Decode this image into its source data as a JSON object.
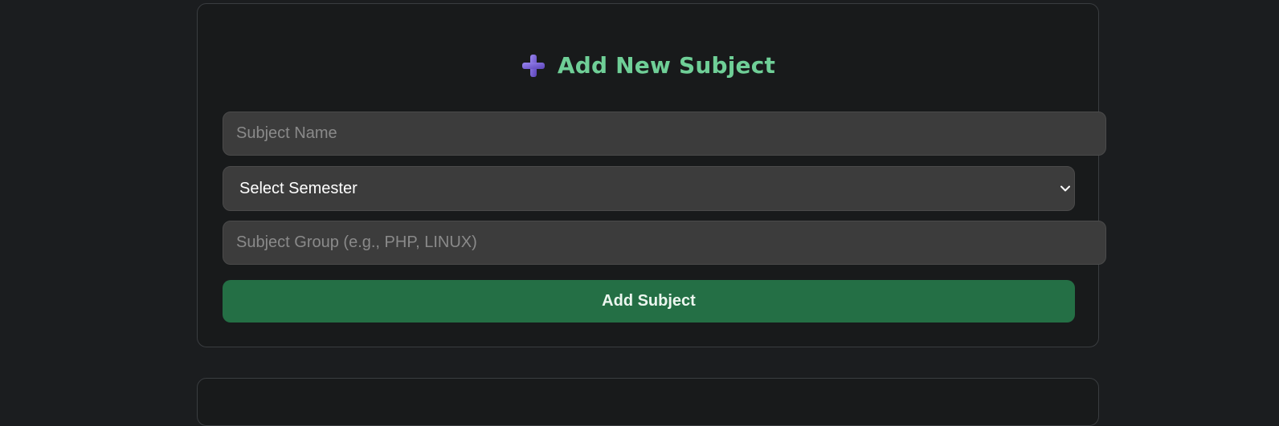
{
  "form": {
    "title": "Add New Subject",
    "title_icon": "plus-icon",
    "subject_name_placeholder": "Subject Name",
    "subject_name_value": "",
    "semester_select": {
      "selected": "Select Semester",
      "options": [
        "Select Semester"
      ]
    },
    "subject_group_placeholder": "Subject Group (e.g., PHP, LINUX)",
    "subject_group_value": "",
    "submit_label": "Add Subject"
  },
  "colors": {
    "page_background": "#1b1d1f",
    "card_background": "#181a1b",
    "title_color": "#6fcf97",
    "icon_color": "#7b61d6",
    "input_background": "#3c3c3c",
    "button_background": "#246f45"
  }
}
